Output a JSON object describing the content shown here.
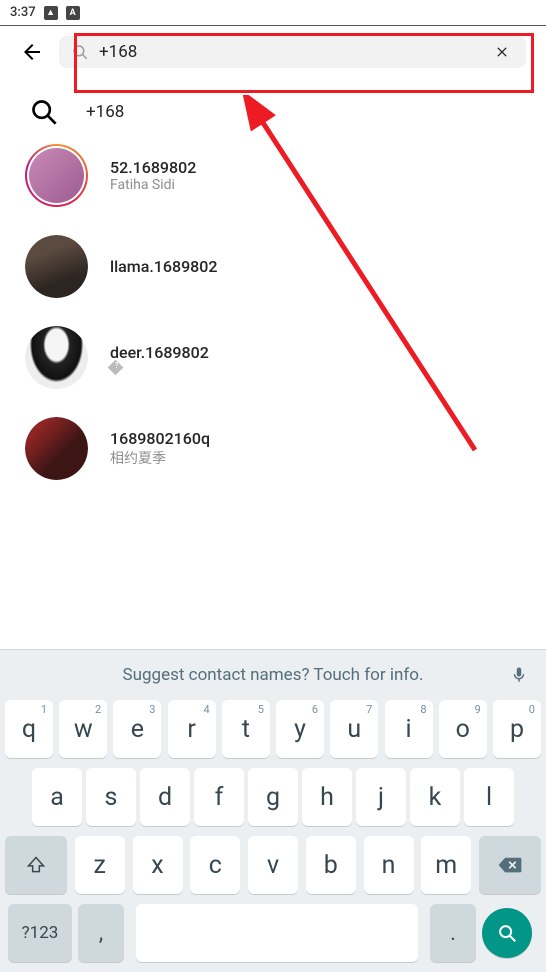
{
  "status": {
    "time": "3:37"
  },
  "search": {
    "query": "+168",
    "summary_term": "+168"
  },
  "results": [
    {
      "username": "52.1689802",
      "subtitle": "Fatiha Sidi",
      "story": true,
      "avatar": "av1"
    },
    {
      "username": "llama.1689802",
      "subtitle": "",
      "story": false,
      "avatar": "av2"
    },
    {
      "username": "deer.1689802",
      "subtitle": "",
      "badge": true,
      "story": false,
      "avatar": "av3"
    },
    {
      "username": "1689802160q",
      "subtitle": "相约夏季",
      "story": false,
      "avatar": "av4"
    }
  ],
  "keyboard": {
    "suggestion": "Suggest contact names? Touch for info.",
    "row1": [
      {
        "k": "q",
        "h": "1"
      },
      {
        "k": "w",
        "h": "2"
      },
      {
        "k": "e",
        "h": "3"
      },
      {
        "k": "r",
        "h": "4"
      },
      {
        "k": "t",
        "h": "5"
      },
      {
        "k": "y",
        "h": "6"
      },
      {
        "k": "u",
        "h": "7"
      },
      {
        "k": "i",
        "h": "8"
      },
      {
        "k": "o",
        "h": "9"
      },
      {
        "k": "p",
        "h": "0"
      }
    ],
    "row2": [
      "a",
      "s",
      "d",
      "f",
      "g",
      "h",
      "j",
      "k",
      "l"
    ],
    "row3": [
      "z",
      "x",
      "c",
      "v",
      "b",
      "n",
      "m"
    ],
    "sym_label": "?123",
    "comma": ",",
    "dot": "."
  }
}
